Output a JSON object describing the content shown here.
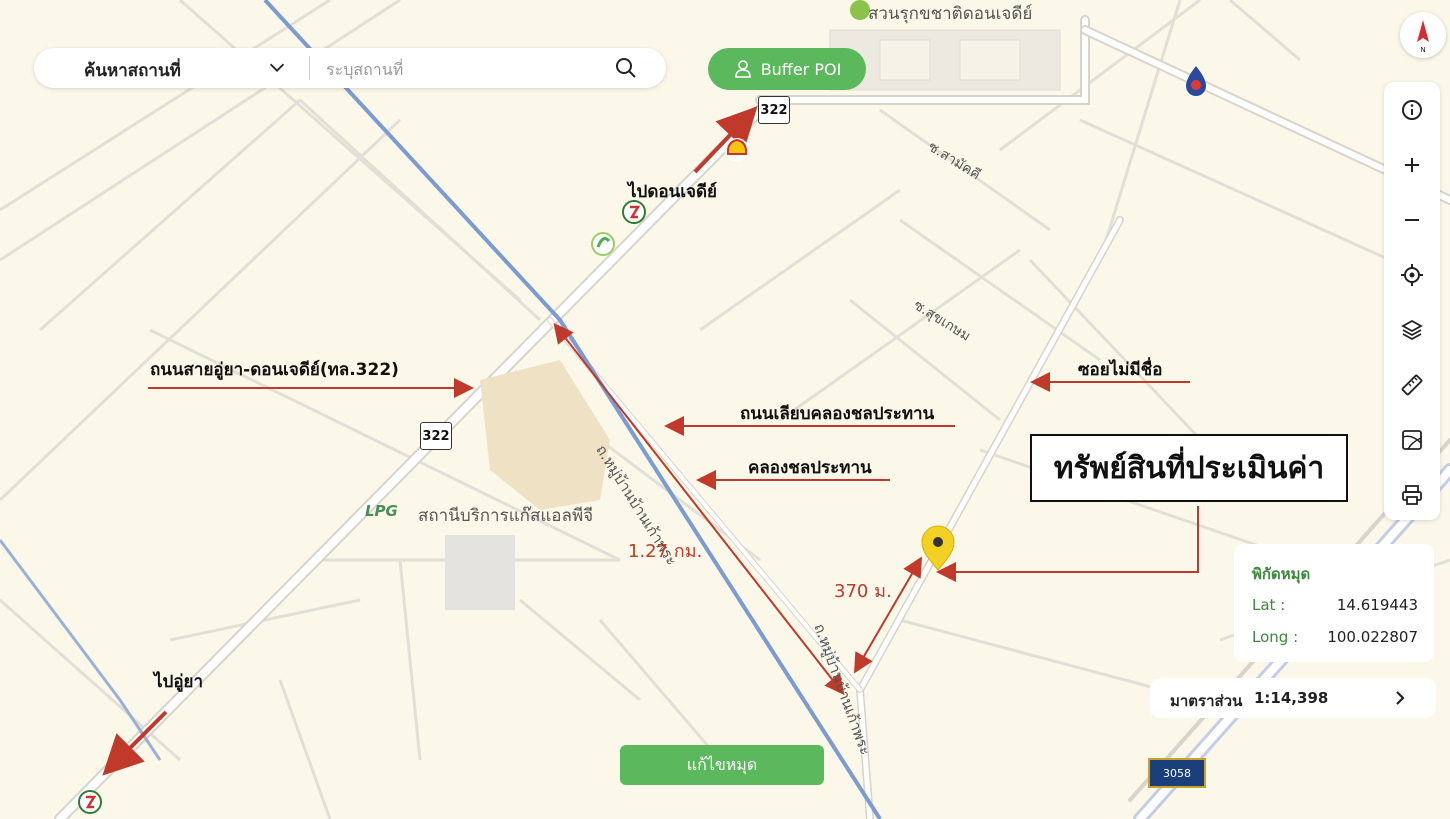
{
  "search": {
    "category": "ค้นหาสถานที่",
    "placeholder": "ระบุสถานที่"
  },
  "buffer_button": "Buffer POI",
  "edit_button": "แก้ไขหมุด",
  "coordinates": {
    "title": "พิกัดหมุด",
    "lat_label": "Lat :",
    "lat_value": "14.619443",
    "long_label": "Long :",
    "long_value": "100.022807"
  },
  "scale": {
    "label": "มาตราส่วน",
    "value": "1:14,398"
  },
  "annotations": {
    "asset": "ทรัพย์สินที่ประเมินค่า",
    "to_don_chedi": "ไปดอนเจดีย์",
    "road_322": "ถนนสายอู่ยา-ดอนเจดีย์(ทล.322)",
    "canal_road": "ถนนเลียบคลองชลประทาน",
    "canal": "คลองชลประทาน",
    "unnamed_soi": "ซอยไม่มีชื่อ",
    "to_u_ya": "ไปอู่ยา",
    "dist_1": "1.27 กม.",
    "dist_2": "370 ม."
  },
  "map_labels": {
    "park": "สวนรุกขชาติดอนเจดีย์",
    "lpg_station": "สถานีบริการแก๊สแอลพีจี",
    "lpg_logo": "LPG",
    "soi_samakkhi": "ซ.สามัคคี",
    "soi_sukkasem": "ซ.สุขเกษม",
    "village_road_1": "ถ.หมู่บ้านบ้านเก้าพระ",
    "village_road_2": "ถ.หมู่บ้านบ้านเก้าพระ",
    "shield_1": "322",
    "shield_2": "322",
    "route_badge": "3058"
  },
  "icons": {
    "compass": "compass-north-icon",
    "info": "info-icon",
    "zoom_in": "plus-icon",
    "zoom_out": "minus-icon",
    "locate": "crosshair-icon",
    "layers": "layers-icon",
    "measure": "ruler-icon",
    "draw": "draw-area-icon",
    "print": "printer-icon",
    "pin": "location-pin-icon",
    "shell": "shell-station-icon",
    "ptt": "ptt-station-icon",
    "bcp": "bangchak-station-icon",
    "pt": "pt-station-icon"
  },
  "colors": {
    "map_bg": "#fbf8e9",
    "road": "#ffffff",
    "canal": "#7c9bd1",
    "arrow": "#c0392b",
    "green_button": "#5cb85c",
    "pin": "#f2d024",
    "route_badge": "#1a3f7a"
  }
}
